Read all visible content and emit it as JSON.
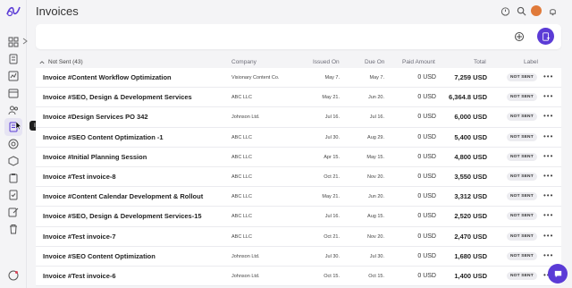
{
  "header": {
    "title": "Invoices"
  },
  "sidebar": {
    "tooltip": "Invoices"
  },
  "table": {
    "group_label": "Not Sent (43)",
    "columns": {
      "company": "Company",
      "issued_on": "Issued On",
      "due_on": "Due On",
      "paid_amount": "Paid Amount",
      "total": "Total",
      "label": "Label"
    },
    "rows": [
      {
        "name": "Invoice #Content Workflow Optimization",
        "company": "Visionary Content Co.",
        "issued": "May 7.",
        "due": "May 7.",
        "paid": "0 USD",
        "total": "7,259 USD",
        "label": "NOT SENT"
      },
      {
        "name": "Invoice #SEO, Design & Development Services",
        "company": "ABC LLC",
        "issued": "May 21.",
        "due": "Jun 20.",
        "paid": "0 USD",
        "total": "6,364.8 USD",
        "label": "NOT SENT"
      },
      {
        "name": "Invoice #Design Services PO 342",
        "company": "Johnson Ltd.",
        "issued": "Jul 16.",
        "due": "Jul 16.",
        "paid": "0 USD",
        "total": "6,000 USD",
        "label": "NOT SENT"
      },
      {
        "name": "Invoice #SEO Content Optimization -1",
        "company": "ABC LLC",
        "issued": "Jul 30.",
        "due": "Aug 29.",
        "paid": "0 USD",
        "total": "5,400 USD",
        "label": "NOT SENT"
      },
      {
        "name": "Invoice #Initial Planning Session",
        "company": "ABC LLC",
        "issued": "Apr 15.",
        "due": "May 15.",
        "paid": "0 USD",
        "total": "4,800 USD",
        "label": "NOT SENT"
      },
      {
        "name": "Invoice #Test invoice-8",
        "company": "ABC LLC",
        "issued": "Oct 21.",
        "due": "Nov 20.",
        "paid": "0 USD",
        "total": "3,550 USD",
        "label": "NOT SENT"
      },
      {
        "name": "Invoice #Content Calendar Development & Rollout",
        "company": "ABC LLC",
        "issued": "May 21.",
        "due": "Jun 20.",
        "paid": "0 USD",
        "total": "3,312 USD",
        "label": "NOT SENT"
      },
      {
        "name": "Invoice #SEO, Design & Development Services-15",
        "company": "ABC LLC",
        "issued": "Jul 16.",
        "due": "Aug 15.",
        "paid": "0 USD",
        "total": "2,520 USD",
        "label": "NOT SENT"
      },
      {
        "name": "Invoice #Test invoice-7",
        "company": "ABC LLC",
        "issued": "Oct 21.",
        "due": "Nov 20.",
        "paid": "0 USD",
        "total": "2,470 USD",
        "label": "NOT SENT"
      },
      {
        "name": "Invoice #SEO Content Optimization",
        "company": "Johnson Ltd.",
        "issued": "Jul 30.",
        "due": "Jul 30.",
        "paid": "0 USD",
        "total": "1,680 USD",
        "label": "NOT SENT"
      },
      {
        "name": "Invoice #Test invoice-6",
        "company": "Johnson Ltd.",
        "issued": "Oct 15.",
        "due": "Oct 15.",
        "paid": "0 USD",
        "total": "1,400 USD",
        "label": "NOT SENT"
      }
    ]
  },
  "colors": {
    "accent": "#5b3bd6",
    "avatar": "#e07a3a",
    "badge_bg": "#ececf0"
  },
  "icons": [
    "logo-icon",
    "grid-icon",
    "document-icon",
    "chart-icon",
    "calendar-icon",
    "users-icon",
    "invoice-icon",
    "target-icon",
    "box-icon",
    "clipboard-icon",
    "checklist-icon",
    "edit-icon",
    "trash-icon",
    "help-icon",
    "timer-icon",
    "search-icon",
    "bell-icon",
    "filter-icon",
    "add-invoice-icon",
    "chat-icon"
  ]
}
